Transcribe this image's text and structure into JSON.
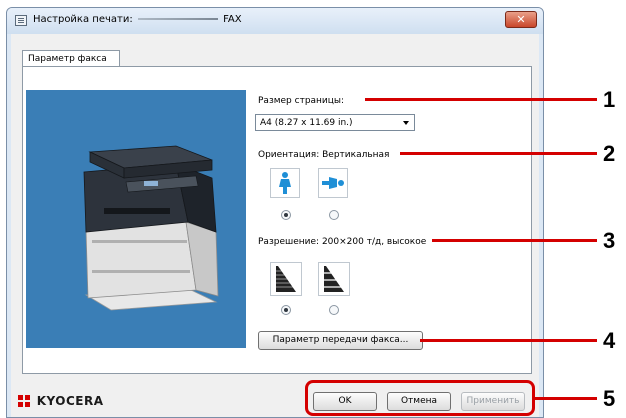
{
  "window": {
    "title_prefix": "Настройка печати:",
    "title_suffix": "FAX",
    "close_symbol": "✕"
  },
  "tabs": [
    {
      "label": "Параметр факса",
      "active": true
    }
  ],
  "page_size": {
    "label": "Размер страницы:",
    "value": "A4 (8.27 x 11.69 in.)"
  },
  "orientation": {
    "label": "Ориентация:",
    "value": "Вертикальная",
    "options": [
      {
        "icon": "portrait-person-icon",
        "selected": true
      },
      {
        "icon": "landscape-person-icon",
        "selected": false
      }
    ]
  },
  "resolution": {
    "label": "Разрешение:",
    "value": "200×200 т/д, высокое",
    "options": [
      {
        "icon": "resolution-high-icon",
        "selected": true
      },
      {
        "icon": "resolution-standard-icon",
        "selected": false
      }
    ]
  },
  "transmission_button": "Параметр передачи факса...",
  "footer": {
    "brand": "KYOCERA",
    "ok": "OK",
    "cancel": "Отмена",
    "apply": "Применить"
  },
  "callouts": [
    "1",
    "2",
    "3",
    "4",
    "5"
  ],
  "colors": {
    "accent_red": "#d40000",
    "preview_bg": "#3a7eb6",
    "window_frame": "#dce8f5",
    "icon_blue": "#1f8fd6"
  }
}
